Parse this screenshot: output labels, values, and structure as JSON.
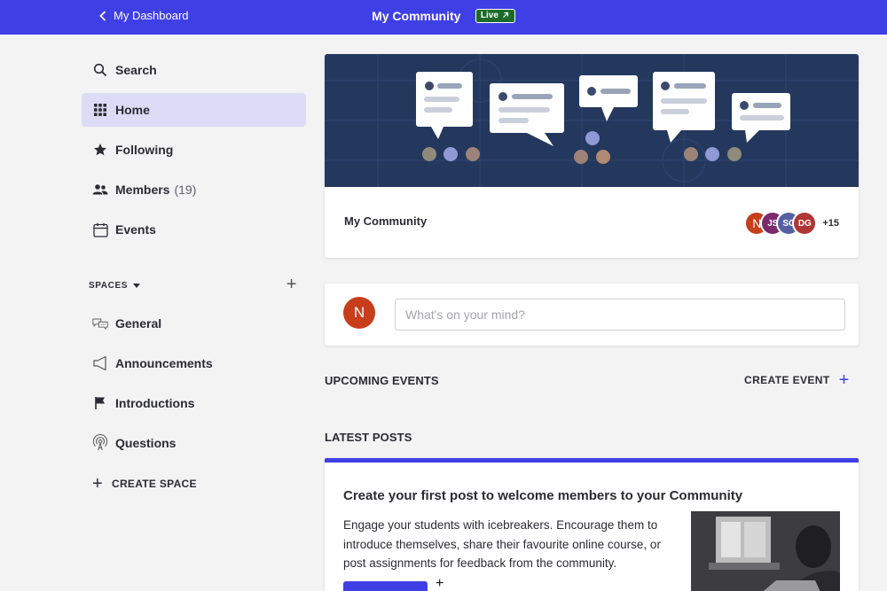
{
  "topbar": {
    "back_label": "My Dashboard",
    "title": "My Community",
    "live_badge": "Live"
  },
  "sidebar": {
    "items": [
      {
        "label": "Search",
        "icon": "search-icon"
      },
      {
        "label": "Home",
        "icon": "grid-icon",
        "active": true
      },
      {
        "label": "Following",
        "icon": "star-icon"
      },
      {
        "label": "Members",
        "count": "(19)",
        "icon": "members-icon"
      },
      {
        "label": "Events",
        "icon": "calendar-icon"
      }
    ],
    "spaces_heading": "SPACES",
    "spaces": [
      {
        "label": "General",
        "icon": "chat-bubbles-icon"
      },
      {
        "label": "Announcements",
        "icon": "megaphone-icon"
      },
      {
        "label": "Introductions",
        "icon": "flag-icon"
      },
      {
        "label": "Questions",
        "icon": "broadcast-icon"
      }
    ],
    "create_space_label": "CREATE SPACE"
  },
  "hero": {
    "community_name": "My Community",
    "avatars": [
      {
        "initials": "N",
        "color": "#c63e1c"
      },
      {
        "initials": "JS",
        "color": "#7b2a6e"
      },
      {
        "initials": "SC",
        "color": "#5560a4"
      },
      {
        "initials": "DG",
        "color": "#b03535"
      }
    ],
    "more_members": "+15"
  },
  "composer": {
    "avatar_initial": "N",
    "placeholder": "What's on your mind?"
  },
  "upcoming": {
    "heading": "UPCOMING EVENTS",
    "create_event_label": "CREATE EVENT"
  },
  "latest": {
    "heading": "LATEST POSTS",
    "post_title": "Create your first post to welcome members to your Community",
    "post_body": "Engage your students with icebreakers. Encourage them to introduce themselves, share their favourite online course, or post assignments for feedback from the community."
  },
  "colors": {
    "accent": "#3f3fe6",
    "banner": "#24385e",
    "live_badge": "#1b6b2a"
  }
}
